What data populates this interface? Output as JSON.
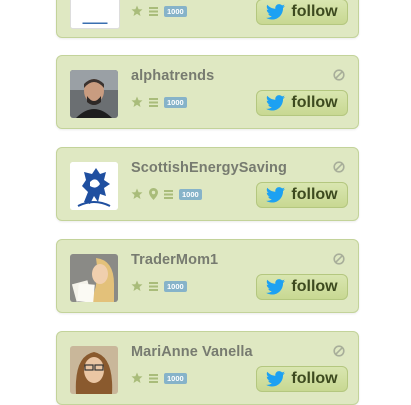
{
  "colors": {
    "card_bg": "#dfe8c2",
    "card_border": "#c3d39a",
    "name_text": "#777b70",
    "twitter_blue": "#1da1f2",
    "badge_bg": "#86b3c9"
  },
  "cards": [
    {
      "name": "",
      "badge": "1000",
      "follow_label": "follow",
      "avatar": "logo-avatar"
    },
    {
      "name": "alphatrends",
      "badge": "1000",
      "follow_label": "follow",
      "avatar": "man-avatar"
    },
    {
      "name": "ScottishEnergySaving",
      "badge": "1000",
      "follow_label": "follow",
      "avatar": "lion-crest-avatar",
      "has_location": true
    },
    {
      "name": "TraderMom1",
      "badge": "1000",
      "follow_label": "follow",
      "avatar": "woman-avatar"
    },
    {
      "name": "MariAnne Vanella",
      "badge": "1000",
      "follow_label": "follow",
      "avatar": "woman-avatar"
    }
  ]
}
